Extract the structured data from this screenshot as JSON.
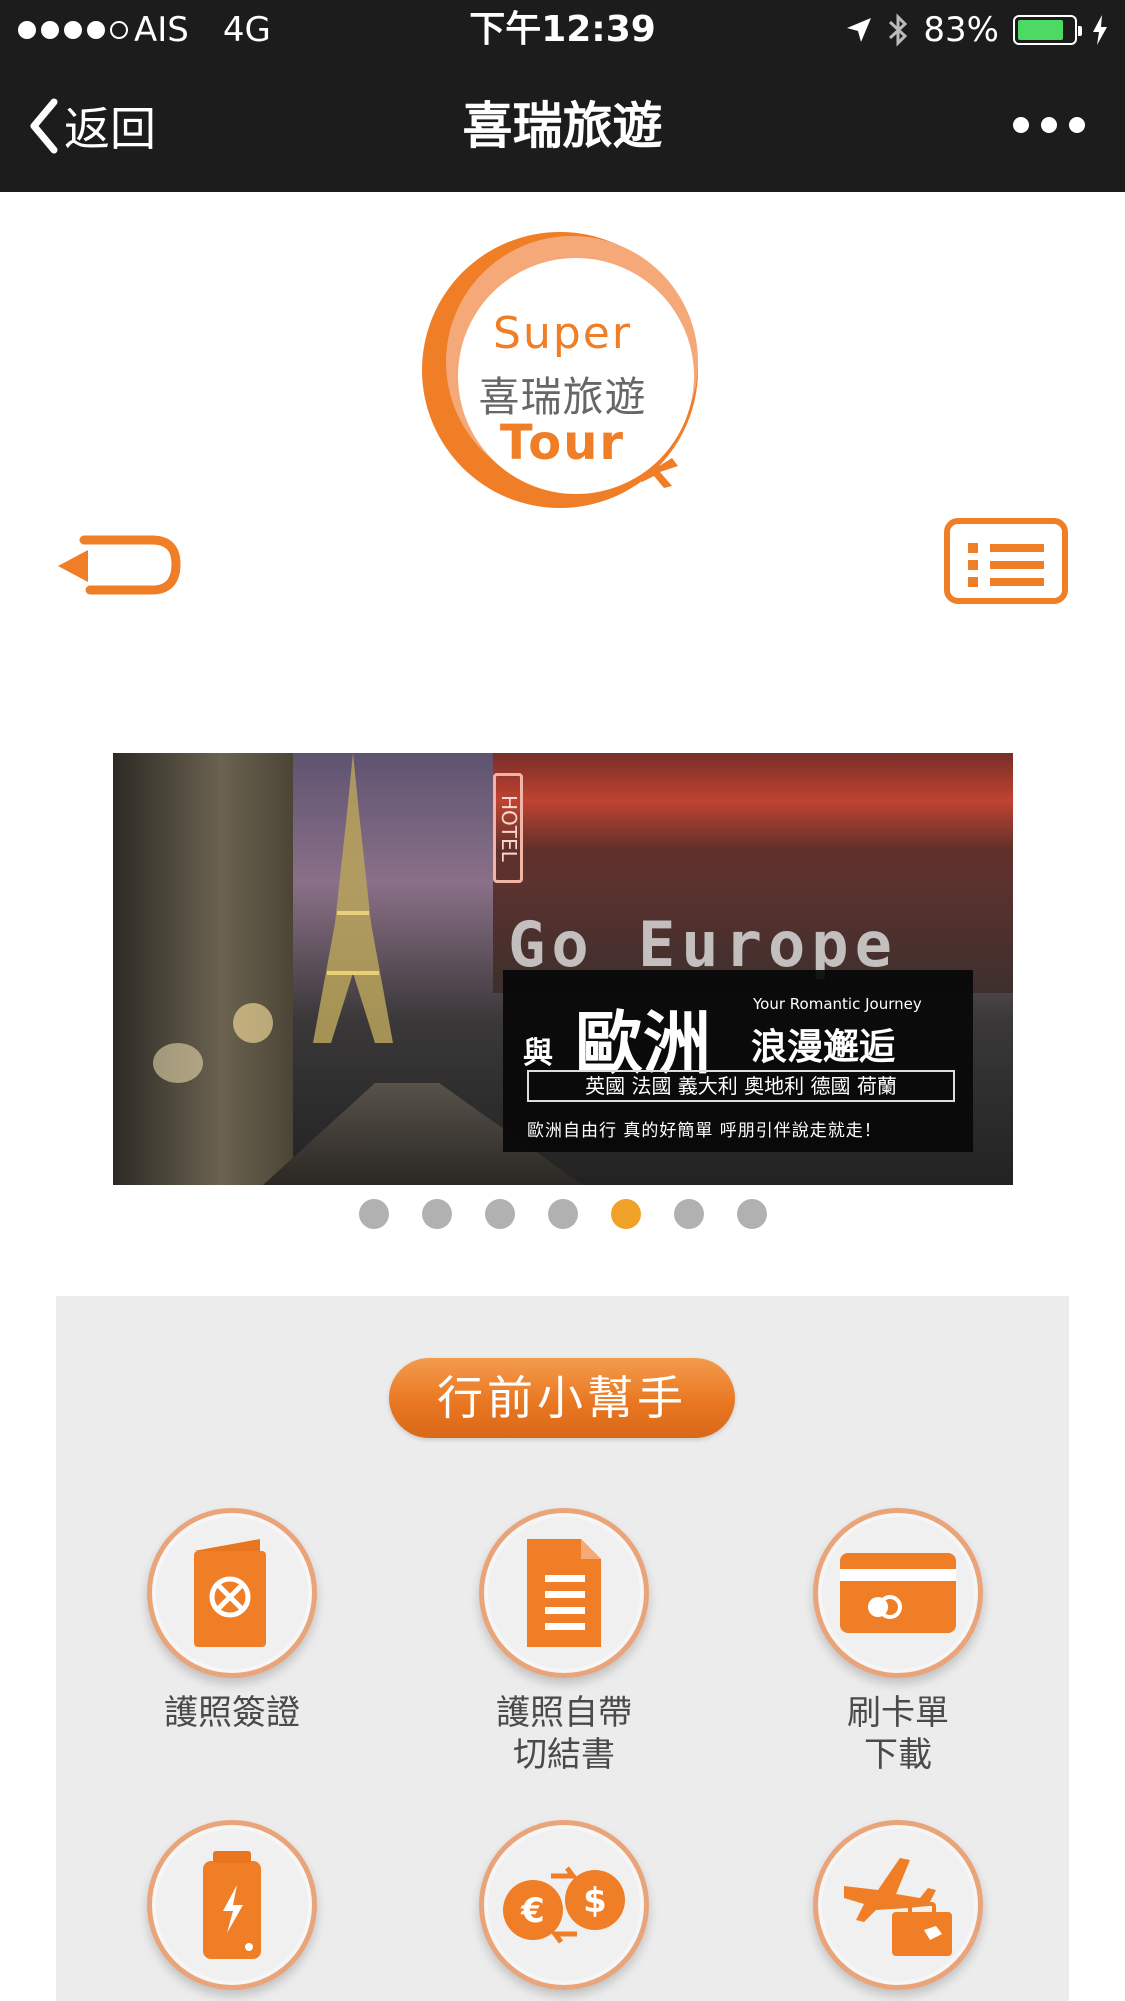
{
  "status_bar": {
    "carrier": "AIS",
    "network": "4G",
    "time": "下午12:39",
    "battery": "83%",
    "battery_level": 0.83
  },
  "nav": {
    "back_label": "返回",
    "title": "喜瑞旅遊"
  },
  "logo": {
    "line1": "Super",
    "line2": "喜瑞旅遊",
    "line3": "Tour"
  },
  "banner": {
    "hotel_sign": "HOTEL",
    "headline_en": "Go Europe",
    "with": "與",
    "europe": "歐洲",
    "tagline_en": "Your Romantic Journey",
    "romance": "浪漫邂逅",
    "countries": "英國  法國  義大利  奧地利  德國  荷蘭",
    "slogan": "歐洲自由行 真的好簡單 呼朋引伴說走就走！"
  },
  "pager": {
    "count": 7,
    "active_index": 4
  },
  "helper": {
    "title": "行前小幫手",
    "items": [
      {
        "label": "護照簽證",
        "icon": "passport-icon"
      },
      {
        "label": "護照自帶\n切結書",
        "icon": "document-icon"
      },
      {
        "label": "刷卡單\n下載",
        "icon": "credit-card-icon"
      },
      {
        "label": "",
        "icon": "power-bank-icon"
      },
      {
        "label": "",
        "icon": "currency-exchange-icon"
      },
      {
        "label": "",
        "icon": "flight-luggage-icon"
      }
    ]
  },
  "colors": {
    "brand_orange": "#ef7e27",
    "pager_active": "#efa128",
    "pager_inactive": "#b1b1b1",
    "header_bg": "#1c1c1c"
  }
}
